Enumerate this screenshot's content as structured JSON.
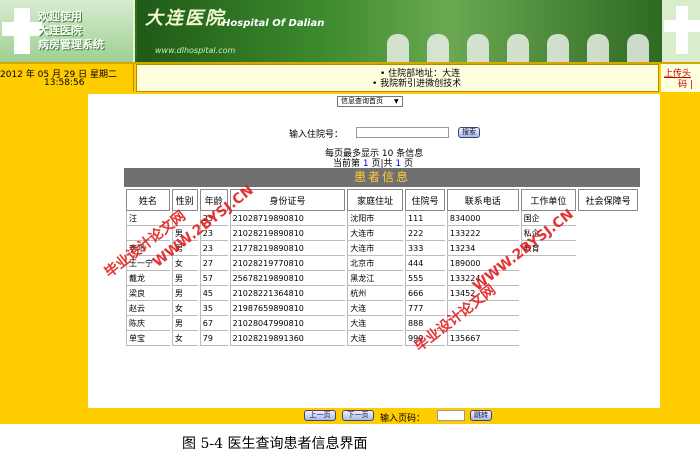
{
  "banner": {
    "welcome_line1": "欢迎使用",
    "welcome_line2": "大连医院",
    "welcome_line3": "病房管理系统",
    "logo_cn": "大连医院",
    "logo_en": "Hospital Of Dalian",
    "url": "www.dlhospital.com"
  },
  "infobar": {
    "date": "2012 年 05 月 29 日 星期二",
    "time": "13:58:56",
    "ticker_line1": "• 住院部地址：大连",
    "ticker_line2": "• 我院新引进微创技术",
    "upload_link": "上传头",
    "upload_link2": "码 |"
  },
  "nav": {
    "selected_option": "信息查询首页"
  },
  "search": {
    "label": "输入住院号：",
    "value": "",
    "button": "搜索"
  },
  "paging": {
    "per_page_prefix": "每页最多显示",
    "per_page": "10",
    "per_page_suffix": "条信息",
    "current_prefix": "当前第",
    "current_page": "1",
    "current_mid": "页|共",
    "total_pages": "1",
    "total_suffix": "页"
  },
  "table": {
    "title": "患者信息",
    "columns": [
      "姓名",
      "性别",
      "年龄",
      "身份证号",
      "家庭住址",
      "住院号",
      "联系电话",
      "工作单位",
      "社会保障号"
    ],
    "rows": [
      [
        "汪",
        "",
        "23",
        "21028719890810",
        "沈阳市",
        "111",
        "834000",
        "国企",
        ""
      ],
      [
        "",
        "男",
        "23",
        "21028219890810",
        "大连市",
        "222",
        "133222",
        "私企",
        ""
      ],
      [
        "李阳",
        "男",
        "23",
        "21778219890810",
        "大连市",
        "333",
        "13234",
        "教育",
        ""
      ],
      [
        "王一宁",
        "女",
        "27",
        "21028219770810",
        "北京市",
        "444",
        "189000",
        "",
        ""
      ],
      [
        "戴龙",
        "男",
        "57",
        "25678219890810",
        "黑龙江",
        "555",
        "133224",
        "",
        ""
      ],
      [
        "梁良",
        "男",
        "45",
        "21028221364810",
        "杭州",
        "666",
        "13452",
        "",
        ""
      ],
      [
        "赵云",
        "女",
        "35",
        "21987659890810",
        "大连",
        "777",
        "",
        "",
        ""
      ],
      [
        "陈庆",
        "男",
        "67",
        "21028047990810",
        "大连",
        "888",
        "",
        "",
        ""
      ],
      [
        "单宝",
        "女",
        "79",
        "21028219891360",
        "大连",
        "999",
        "135667",
        "",
        ""
      ]
    ]
  },
  "bottom": {
    "prev": "上一页",
    "next": "下一页",
    "page_label": "输入页码：",
    "page_value": "",
    "jump": "跳转"
  },
  "watermarks": {
    "site": "WWW.2BYSJ.CN",
    "brand": "毕业设计论文网"
  },
  "caption": "图 5-4  医生查询患者信息界面"
}
